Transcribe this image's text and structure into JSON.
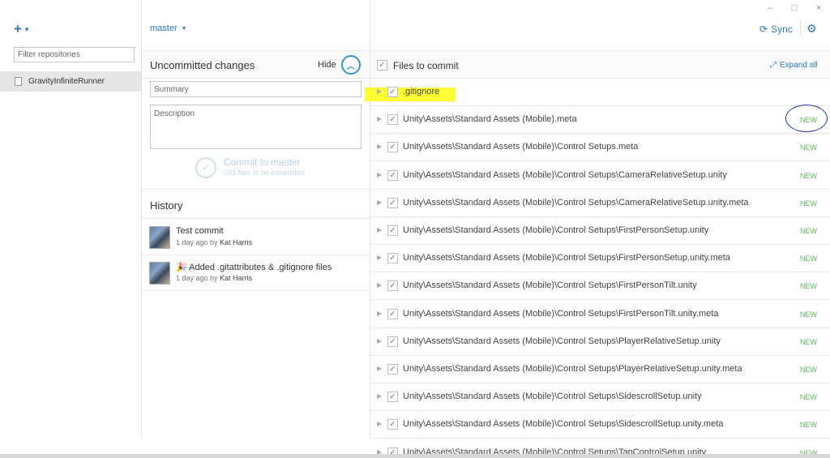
{
  "window": {
    "minimize": "–",
    "maximize": "□",
    "close": "×"
  },
  "sidebar": {
    "add_icon": "+",
    "filter_placeholder": "Filter repositories",
    "repositories": [
      {
        "name": "GravityInfiniteRunner"
      }
    ]
  },
  "branch": {
    "name": "master",
    "caret": "▼"
  },
  "uncommitted": {
    "title": "Uncommitted changes",
    "hide_label": "Hide",
    "summary_placeholder": "Summary",
    "description_placeholder": "Description",
    "commit_label": "Commit to master",
    "commit_sub": "503 files to be committed"
  },
  "history": {
    "title": "History",
    "items": [
      {
        "message": "Test commit",
        "time": "1 day ago by",
        "author": "Kat Harris"
      },
      {
        "message": "🎉 Added .gitattributes & .gitignore files",
        "time": "1 day ago by",
        "author": "Kat Harris"
      }
    ]
  },
  "toolbar": {
    "sync_label": "Sync",
    "sync_icon": "⟳",
    "settings_icon": "⚙"
  },
  "files": {
    "header": "Files to commit",
    "expand_label": "Expand all",
    "new_label": "NEW",
    "items": [
      {
        "path": ".gitignore",
        "status": ""
      },
      {
        "path": "Unity\\Assets\\Standard Assets (Mobile).meta",
        "status": "NEW"
      },
      {
        "path": "Unity\\Assets\\Standard Assets (Mobile)\\Control Setups.meta",
        "status": "NEW"
      },
      {
        "path": "Unity\\Assets\\Standard Assets (Mobile)\\Control Setups\\CameraRelativeSetup.unity",
        "status": "NEW"
      },
      {
        "path": "Unity\\Assets\\Standard Assets (Mobile)\\Control Setups\\CameraRelativeSetup.unity.meta",
        "status": "NEW"
      },
      {
        "path": "Unity\\Assets\\Standard Assets (Mobile)\\Control Setups\\FirstPersonSetup.unity",
        "status": "NEW"
      },
      {
        "path": "Unity\\Assets\\Standard Assets (Mobile)\\Control Setups\\FirstPersonSetup.unity.meta",
        "status": "NEW"
      },
      {
        "path": "Unity\\Assets\\Standard Assets (Mobile)\\Control Setups\\FirstPersonTilt.unity",
        "status": "NEW"
      },
      {
        "path": "Unity\\Assets\\Standard Assets (Mobile)\\Control Setups\\FirstPersonTilt.unity.meta",
        "status": "NEW"
      },
      {
        "path": "Unity\\Assets\\Standard Assets (Mobile)\\Control Setups\\PlayerRelativeSetup.unity",
        "status": "NEW"
      },
      {
        "path": "Unity\\Assets\\Standard Assets (Mobile)\\Control Setups\\PlayerRelativeSetup.unity.meta",
        "status": "NEW"
      },
      {
        "path": "Unity\\Assets\\Standard Assets (Mobile)\\Control Setups\\SidescrollSetup.unity",
        "status": "NEW"
      },
      {
        "path": "Unity\\Assets\\Standard Assets (Mobile)\\Control Setups\\SidescrollSetup.unity.meta",
        "status": "NEW"
      },
      {
        "path": "Unity\\Assets\\Standard Assets (Mobile)\\Control Setups\\TapControlSetup.unity",
        "status": "NEW"
      }
    ]
  }
}
